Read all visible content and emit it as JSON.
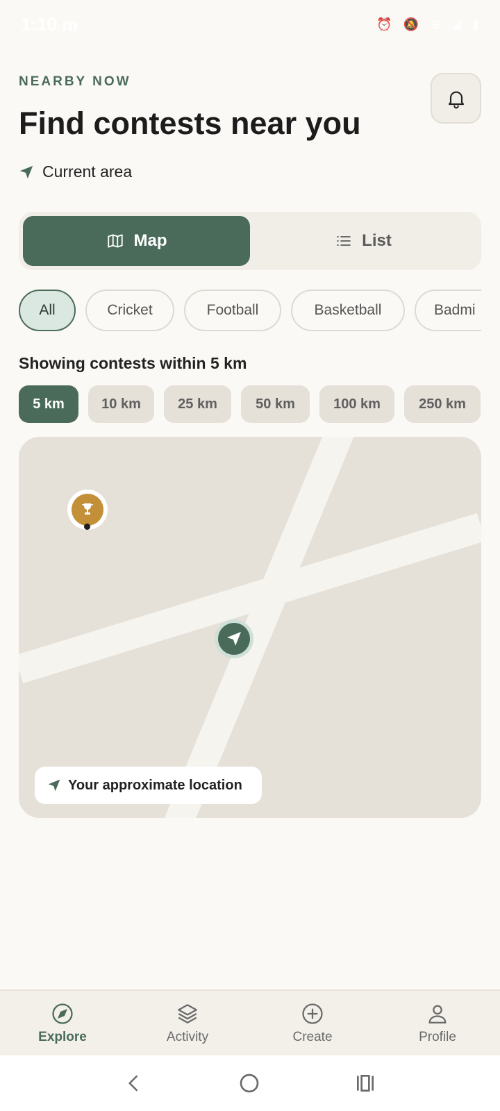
{
  "status_bar": {
    "time": "1:10 m",
    "icons": [
      "alarm-icon",
      "mute-icon",
      "wifi-icon",
      "signal-icon",
      "battery-icon"
    ]
  },
  "header": {
    "eyebrow": "NEARBY NOW",
    "title": "Find contests near you",
    "area_label": "Current area"
  },
  "view_toggle": {
    "map_label": "Map",
    "list_label": "List",
    "selected": "Map"
  },
  "sports": {
    "selected": "All",
    "items": [
      "All",
      "Cricket",
      "Football",
      "Basketball",
      "Badmi"
    ]
  },
  "radius": {
    "label": "Showing contests within 5 km",
    "selected": "5 km",
    "options": [
      "5 km",
      "10 km",
      "25 km",
      "50 km",
      "100 km",
      "250 km"
    ]
  },
  "map": {
    "location_label": "Your approximate location",
    "contest_marker_icon": "trophy-icon",
    "user_marker_icon": "navigation-arrow-icon"
  },
  "bottom_nav": {
    "selected": "Explore",
    "items": [
      {
        "label": "Explore",
        "icon": "compass-icon"
      },
      {
        "label": "Activity",
        "icon": "layers-icon"
      },
      {
        "label": "Create",
        "icon": "plus-circle-icon"
      },
      {
        "label": "Profile",
        "icon": "user-icon"
      }
    ]
  },
  "colors": {
    "accent": "#4a6b5a",
    "background": "#fbf9f5",
    "map_land": "#e5e0d8",
    "map_road": "#f6f4ef",
    "trophy": "#c48f39"
  }
}
